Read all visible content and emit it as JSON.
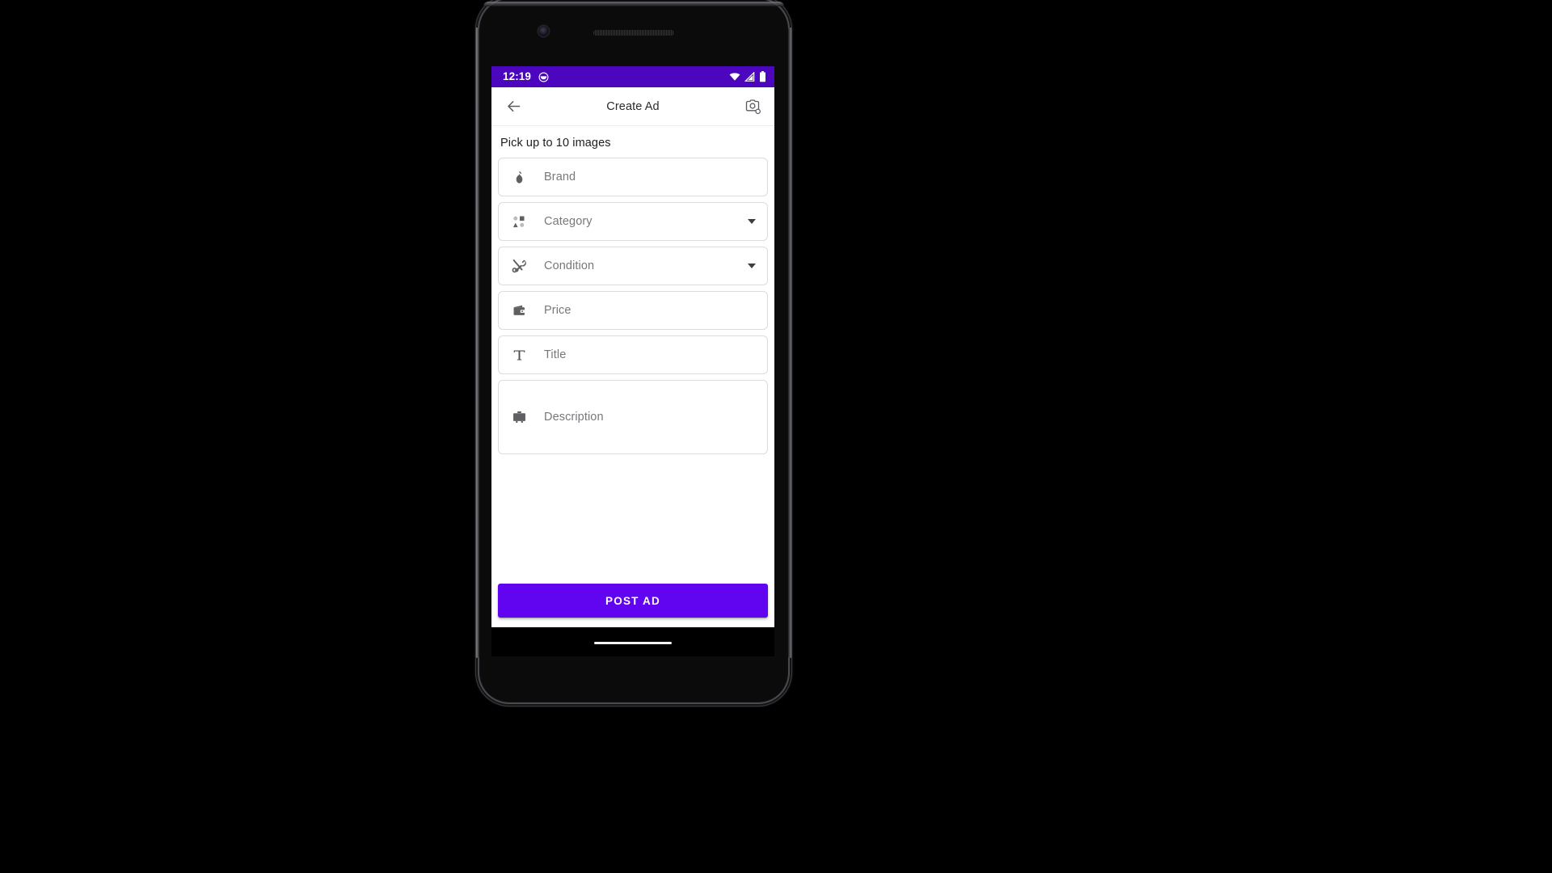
{
  "device": {
    "type": "android-phone-mockup",
    "frame_color": "#0b0b0c"
  },
  "status_bar": {
    "time": "12:19",
    "background_color": "#4b06be",
    "foreground_color": "#ffffff",
    "left_icons": [
      "notification-circle-icon"
    ],
    "right_icons": [
      "wifi-icon",
      "cellular-signal-icon",
      "battery-icon"
    ]
  },
  "app_bar": {
    "title": "Create Ad",
    "back_icon": "arrow-back-icon",
    "action_icon": "add-a-photo-icon",
    "background_color": "#ffffff",
    "title_color": "#2b2b2d"
  },
  "main": {
    "picker_label": "Pick up to 10 images",
    "fields": [
      {
        "name": "brand",
        "label": "Brand",
        "placeholder": "Brand",
        "value": "",
        "icon": "pear-brand-icon",
        "type": "text",
        "has_dropdown": false
      },
      {
        "name": "category",
        "label": "Category",
        "placeholder": "Category",
        "value": "",
        "icon": "category-shapes-icon",
        "type": "select",
        "has_dropdown": true
      },
      {
        "name": "condition",
        "label": "Condition",
        "placeholder": "Condition",
        "value": "",
        "icon": "handyman-tools-icon",
        "type": "select",
        "has_dropdown": true
      },
      {
        "name": "price",
        "label": "Price",
        "placeholder": "Price",
        "value": "",
        "icon": "wallet-icon",
        "type": "number",
        "has_dropdown": false
      },
      {
        "name": "title",
        "label": "Title",
        "placeholder": "Title",
        "value": "",
        "icon": "text-format-t-icon",
        "type": "text",
        "has_dropdown": false
      },
      {
        "name": "description",
        "label": "Description",
        "placeholder": "Description",
        "value": "",
        "icon": "briefcase-icon",
        "type": "textarea",
        "has_dropdown": false
      }
    ],
    "placeholder_color": "#77787c",
    "field_border_color": "#dcdcde"
  },
  "footer": {
    "post_ad_label": "POST AD",
    "post_ad_color": "#6104f0",
    "post_ad_text_color": "#ffffff"
  },
  "gesture_bar": {
    "indicator": "home-indicator"
  }
}
